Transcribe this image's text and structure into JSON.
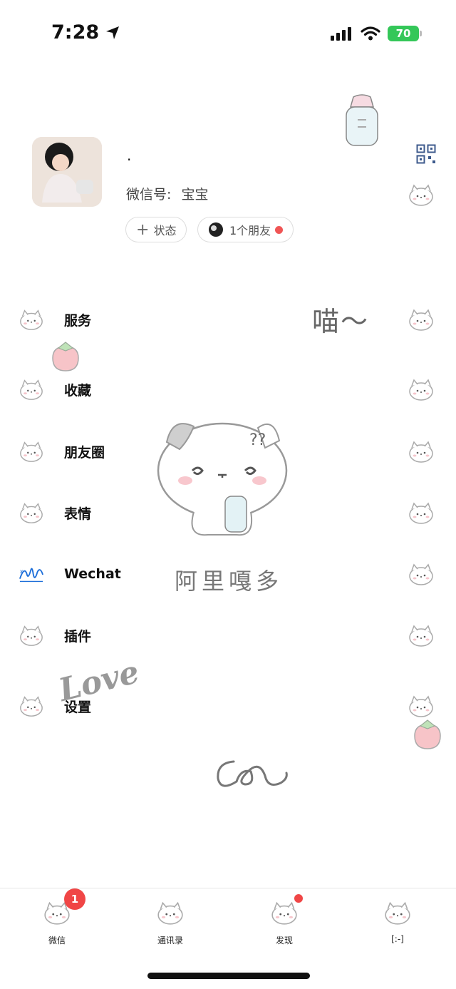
{
  "status_bar": {
    "time": "7:28",
    "battery": "70"
  },
  "profile": {
    "nickname": ".",
    "wechat_id_label": "微信号:",
    "wechat_id": "宝宝",
    "status_button": "状态",
    "friends_button": "1个朋友"
  },
  "menu": [
    {
      "label": "服务",
      "icon": "cat-icon"
    },
    {
      "label": "收藏",
      "icon": "cat-icon"
    },
    {
      "label": "朋友圈",
      "icon": "cat-icon"
    },
    {
      "label": "表情",
      "icon": "cat-icon"
    },
    {
      "label": "Wechat",
      "icon": "signature-icon"
    },
    {
      "label": "插件",
      "icon": "cat-icon"
    },
    {
      "label": "设置",
      "icon": "cat-icon"
    }
  ],
  "decor": {
    "miao": "喵～",
    "ali": "阿里嘎多",
    "love": "Love"
  },
  "tabs": [
    {
      "label": "微信",
      "badge": "1"
    },
    {
      "label": "通讯录"
    },
    {
      "label": "发现"
    },
    {
      "label": "[:-]"
    }
  ],
  "colors": {
    "badge": "#f04646",
    "battery": "#34c759"
  }
}
